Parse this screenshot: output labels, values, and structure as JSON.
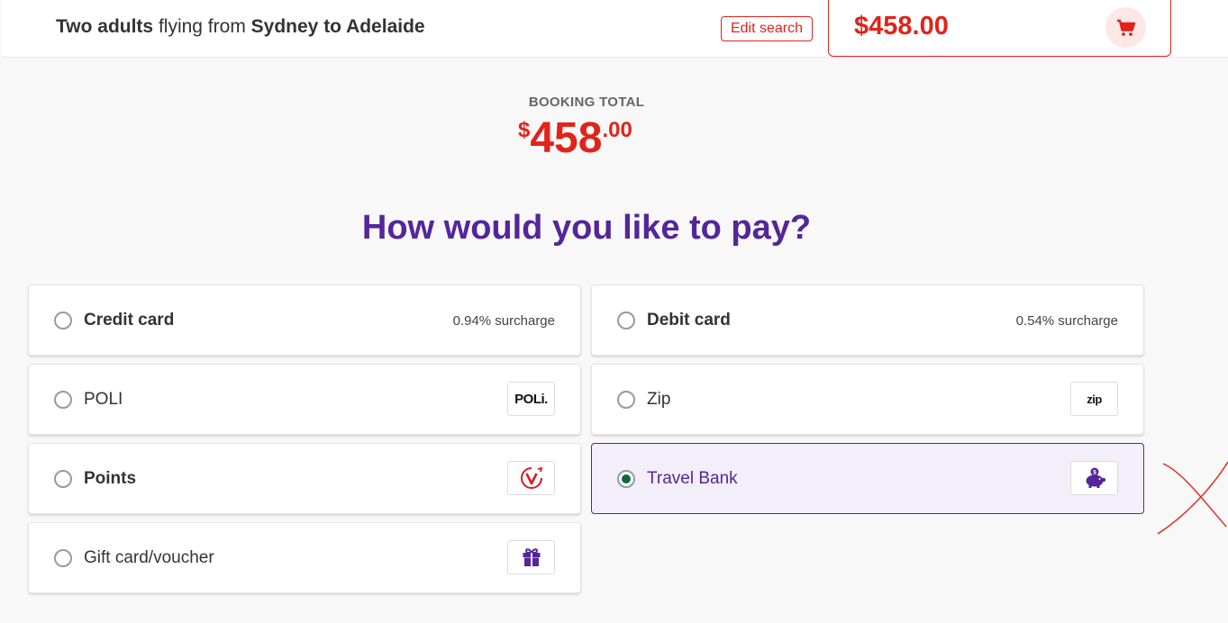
{
  "header": {
    "trip_passengers": "Two adults",
    "trip_mid": "flying from",
    "trip_route": "Sydney to Adelaide",
    "edit_label": "Edit search",
    "cart_total": "$458.00",
    "cart_icon": "shopping-cart-icon"
  },
  "booking": {
    "label": "BOOKING TOTAL",
    "currency": "$",
    "amount_main": "458",
    "amount_cents": ".00"
  },
  "question": "How would you like to pay?",
  "options": [
    {
      "label": "Credit card",
      "extra": "0.94% surcharge",
      "selected": false
    },
    {
      "label": "Debit card",
      "extra": "0.54% surcharge",
      "selected": false
    },
    {
      "label": "POLI",
      "logo_text": "POLi.",
      "icon": "poli-logo-icon",
      "selected": false
    },
    {
      "label": "Zip",
      "logo_text": "zip",
      "icon": "zip-logo-icon",
      "selected": false
    },
    {
      "label": "Points",
      "icon": "velocity-points-icon",
      "selected": false
    },
    {
      "label": "Travel Bank",
      "icon": "piggy-bank-icon",
      "selected": true
    },
    {
      "label": "Gift card/voucher",
      "icon": "gift-icon",
      "selected": false
    }
  ],
  "colors": {
    "brand_red": "#e2231a",
    "brand_purple": "#55259a",
    "selected_radio": "#0a6b3a",
    "selected_bg": "#f3effa"
  }
}
